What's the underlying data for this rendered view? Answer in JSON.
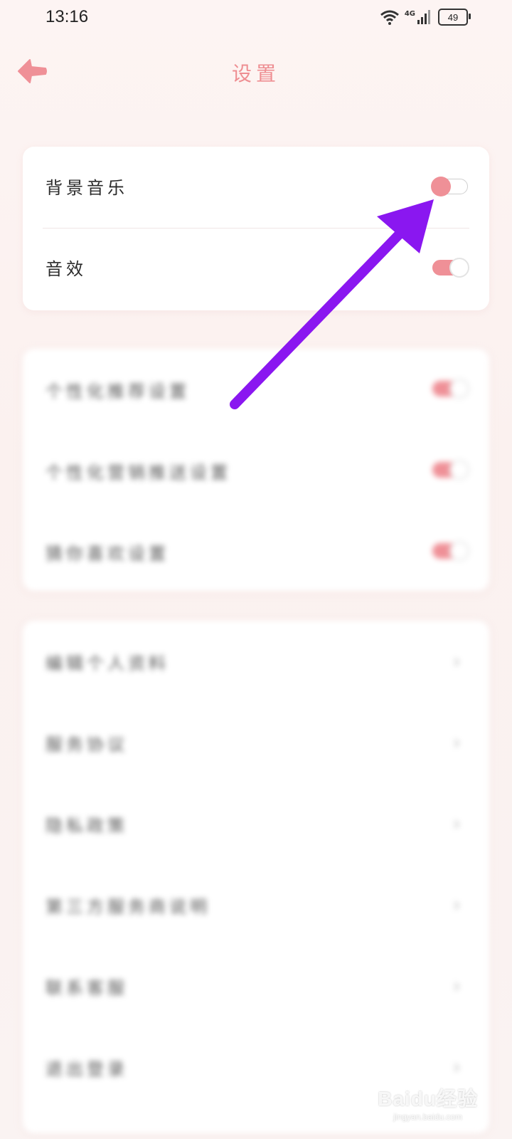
{
  "status_bar": {
    "time": "13:16",
    "network": "4G",
    "battery": "49"
  },
  "header": {
    "title": "设置",
    "back_icon": "back-arrow-icon"
  },
  "sound_settings": [
    {
      "label": "背景音乐",
      "enabled": false
    },
    {
      "label": "音效",
      "enabled": true
    }
  ],
  "privacy_settings_blurred": [
    {
      "label": "个性化推荐设置",
      "enabled": true
    },
    {
      "label": "个性化营销推送设置",
      "enabled": true
    },
    {
      "label": "猜你喜欢设置",
      "enabled": true
    }
  ],
  "account_links_blurred": [
    {
      "label": "编辑个人资料"
    },
    {
      "label": "服务协议"
    },
    {
      "label": "隐私政策"
    },
    {
      "label": "第三方服务商说明"
    },
    {
      "label": "联系客服"
    },
    {
      "label": "退出登录"
    }
  ],
  "colors": {
    "accent": "#ef9097",
    "annotation_arrow": "#8a17f0"
  },
  "watermark": {
    "main": "Baidu经验",
    "sub": "jingyan.baidu.com"
  }
}
